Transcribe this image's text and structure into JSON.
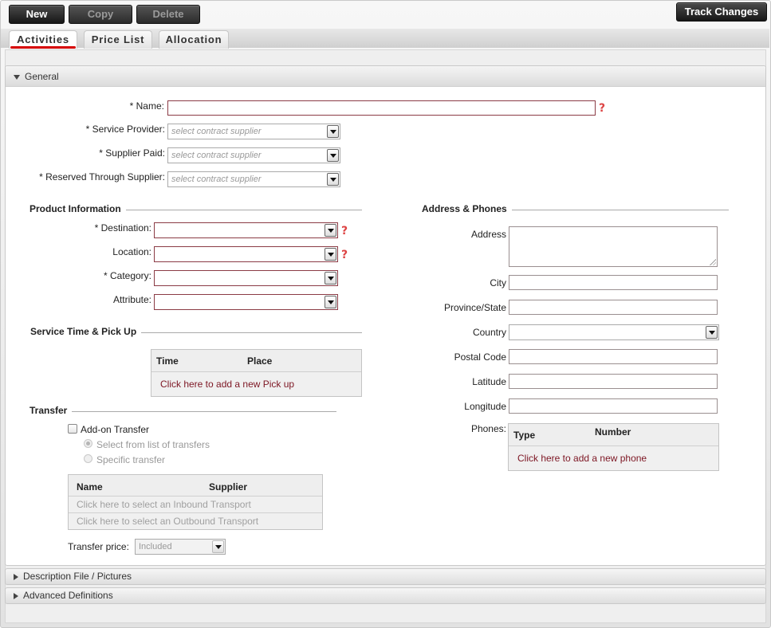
{
  "toolbar": {
    "new_label": "New",
    "copy_label": "Copy",
    "delete_label": "Delete",
    "track_changes_label": "Track Changes"
  },
  "tabs": [
    {
      "label": "Activities",
      "active": true
    },
    {
      "label": "Price List",
      "active": false
    },
    {
      "label": "Allocation",
      "active": false
    }
  ],
  "general": {
    "header": "General",
    "name_label": "* Name:",
    "name_value": "",
    "service_provider_label": "* Service Provider:",
    "supplier_paid_label": "* Supplier Paid:",
    "reserved_through_label": "* Reserved Through Supplier:",
    "supplier_placeholder": "select contract supplier"
  },
  "product_info": {
    "title": "Product Information",
    "destination_label": "* Destination:",
    "location_label": "Location:",
    "category_label": "* Category:",
    "attribute_label": "Attribute:"
  },
  "service_time": {
    "title": "Service Time & Pick Up",
    "columns": [
      "Time",
      "Place"
    ],
    "add_link": "Click here to add a new Pick up"
  },
  "transfer": {
    "title": "Transfer",
    "addon_label": "Add-on Transfer",
    "option_list": "Select from list of transfers",
    "option_specific": "Specific transfer",
    "columns": [
      "Name",
      "Supplier"
    ],
    "inbound_link": "Click here to select an Inbound Transport",
    "outbound_link": "Click here to select an Outbound Transport",
    "price_label": "Transfer price:",
    "price_value": "Included"
  },
  "address": {
    "title": "Address & Phones",
    "address_label": "Address",
    "city_label": "City",
    "province_label": "Province/State",
    "country_label": "Country",
    "postal_label": "Postal Code",
    "latitude_label": "Latitude",
    "longitude_label": "Longitude",
    "phones_label": "Phones:",
    "phone_columns": [
      "Type",
      "Number"
    ],
    "add_phone_link": "Click here to add a new phone"
  },
  "collapsed_sections": {
    "description": "Description File / Pictures",
    "advanced": "Advanced Definitions"
  },
  "colors": {
    "accent": "#d60000",
    "link": "#7d1623",
    "field_border": "#8b3b45"
  }
}
